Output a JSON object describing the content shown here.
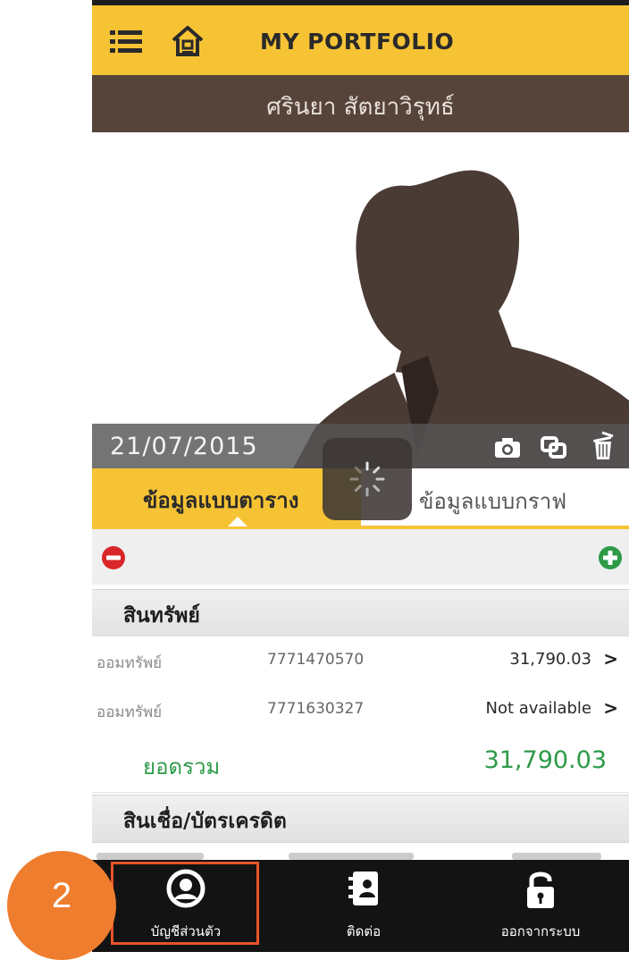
{
  "header": {
    "title": "MY PORTFOLIO",
    "menu_icon": "list-menu-icon",
    "home_icon": "home-icon",
    "accent_color": "#F6C335"
  },
  "profile": {
    "name": "ศรินยา สัตยาวิรุทธ์",
    "date": "21/07/2015",
    "photo_icons": [
      "camera-icon",
      "copy-icon",
      "trash-icon"
    ]
  },
  "tabs": {
    "table_label": "ข้อมูลแบบตาราง",
    "graph_label": "ข้อมูลแบบกราฟ",
    "selected": "table"
  },
  "assets": {
    "heading": "สินทรัพย์",
    "rows": [
      {
        "type": "ออมทรัพย์",
        "account": "7771470570",
        "amount": "31,790.03",
        "chevron": ">"
      },
      {
        "type": "ออมทรัพย์",
        "account": "7771630327",
        "amount": "Not available",
        "chevron": ">"
      }
    ],
    "total_label": "ยอดรวม",
    "total_value": "31,790.03",
    "total_color": "#2E9A48"
  },
  "credit": {
    "heading": "สินเชื่อ/บัตรเครดิต"
  },
  "bottom_nav": {
    "items": [
      {
        "label": "บัญชีส่วนตัว",
        "icon": "user-account-icon"
      },
      {
        "label": "ติดต่อ",
        "icon": "contact-book-icon"
      },
      {
        "label": "ออกจากระบบ",
        "icon": "unlock-icon"
      }
    ]
  },
  "annotation": {
    "step_number": "2",
    "badge_color": "#EF7D2E",
    "highlight_color": "#E8542B"
  }
}
